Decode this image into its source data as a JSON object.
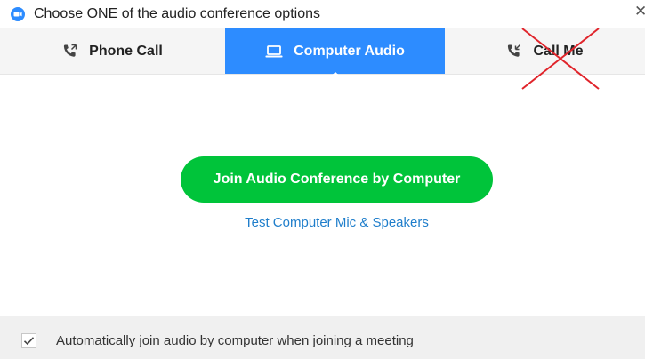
{
  "window": {
    "title": "Choose ONE of the audio conference options",
    "close_glyph": "✕"
  },
  "tabs": [
    {
      "label": "Phone Call",
      "icon": "phone-icon",
      "active": false
    },
    {
      "label": "Computer Audio",
      "icon": "laptop-icon",
      "active": true
    },
    {
      "label": "Call Me",
      "icon": "phone-incoming-icon",
      "active": false,
      "crossed_out": true
    }
  ],
  "main": {
    "join_button_label": "Join Audio Conference by Computer",
    "test_link_label": "Test Computer Mic & Speakers"
  },
  "footer": {
    "auto_join_checked": true,
    "auto_join_label": "Automatically join audio by computer when joining a meeting"
  },
  "colors": {
    "accent": "#2d8cff",
    "join_green": "#00c43a",
    "link": "#1f7ecb",
    "cross_red": "#e0242b",
    "tabbar_bg": "#f5f5f5",
    "footer_bg": "#f0f0f0"
  }
}
